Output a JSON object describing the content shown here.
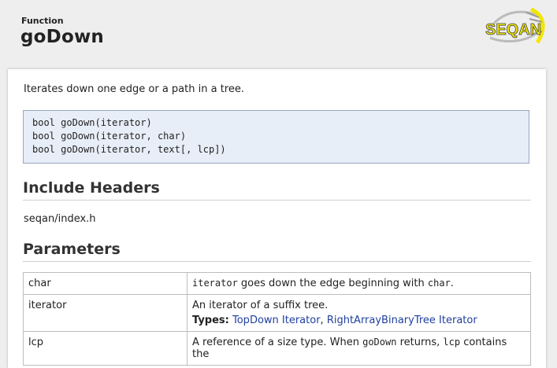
{
  "header": {
    "kind": "Function",
    "title": "goDown",
    "logo_text": "SEQAN"
  },
  "colors": {
    "link": "#1f3f9f",
    "signature_bg": "#e8eef8",
    "logo_yellow": "#f2e600"
  },
  "summary": "Iterates down one edge or a path in a tree.",
  "signatures": [
    "bool goDown(iterator)",
    "bool goDown(iterator, char)",
    "bool goDown(iterator, text[, lcp])"
  ],
  "include_headers": {
    "heading": "Include Headers",
    "file": "seqan/index.h"
  },
  "parameters": {
    "heading": "Parameters",
    "rows": [
      {
        "name": "char",
        "desc_code1": "iterator",
        "desc_text1": " goes down the edge beginning with ",
        "desc_code2": "char",
        "desc_text2": "."
      },
      {
        "name": "iterator",
        "desc": "An iterator of a suffix tree.",
        "types_label": "Types:",
        "types": [
          "TopDown Iterator",
          "RightArrayBinaryTree Iterator"
        ],
        "types_sep": ", "
      },
      {
        "name": "lcp",
        "desc_text1": "A reference of a size type. When ",
        "desc_code1": "goDown",
        "desc_text2": " returns, ",
        "desc_code2": "lcp",
        "desc_text3": " contains the"
      }
    ]
  }
}
